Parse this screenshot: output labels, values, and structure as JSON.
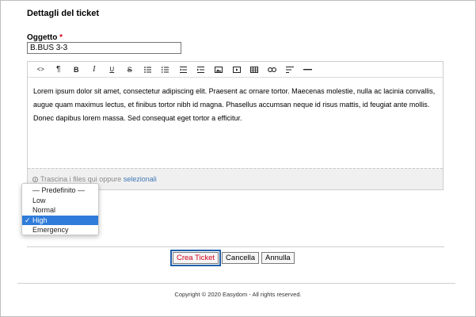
{
  "form": {
    "section_title": "Dettagli del ticket",
    "subject_label": "Oggetto",
    "required_mark": "*",
    "subject_value": "B.BUS 3-3"
  },
  "editor": {
    "toolbar": [
      {
        "icon": "code-icon",
        "glyph": "<>"
      },
      {
        "icon": "paragraph-icon",
        "glyph": "¶"
      },
      {
        "icon": "bold-icon",
        "glyph": "B"
      },
      {
        "icon": "italic-icon",
        "glyph": "I"
      },
      {
        "icon": "underline-icon",
        "glyph": "U"
      },
      {
        "icon": "strikethrough-icon",
        "glyph": "S"
      },
      {
        "icon": "bulleted-list-icon",
        "glyph": ""
      },
      {
        "icon": "numbered-list-icon",
        "glyph": ""
      },
      {
        "icon": "outdent-icon",
        "glyph": ""
      },
      {
        "icon": "indent-icon",
        "glyph": ""
      },
      {
        "icon": "image-icon",
        "glyph": ""
      },
      {
        "icon": "video-icon",
        "glyph": ""
      },
      {
        "icon": "table-icon",
        "glyph": ""
      },
      {
        "icon": "link-icon",
        "glyph": ""
      },
      {
        "icon": "align-icon",
        "glyph": ""
      },
      {
        "icon": "horizontal-rule-icon",
        "glyph": ""
      }
    ],
    "content": "Lorem ipsum dolor sit amet, consectetur adipiscing elit. Praesent ac ornare tortor. Maecenas molestie, nulla ac lacinia convallis, augue quam maximus lectus, et finibus tortor nibh id magna. Phasellus accumsan neque id risus mattis, id feugiat ante mollis. Donec dapibus lorem massa. Sed consequat eget tortor a efficitur.",
    "dropzone_text": "Trascina i files qui oppure",
    "dropzone_link": "selezionali"
  },
  "priority_dropdown": {
    "options": [
      "— Predefinito —",
      "Low",
      "Normal",
      "High",
      "Emergency"
    ],
    "selected": "High",
    "check_mark": "✓"
  },
  "buttons": {
    "create": "Crea Ticket",
    "delete": "Cancella",
    "cancel": "Annulla"
  },
  "footer": {
    "copyright": "Copyright © 2020 Easydom - All rights reserved."
  },
  "colors": {
    "required": "#d0021b",
    "link": "#3f76b5",
    "selection": "#2f7bd9",
    "focus_outline": "#1f5fa8"
  }
}
